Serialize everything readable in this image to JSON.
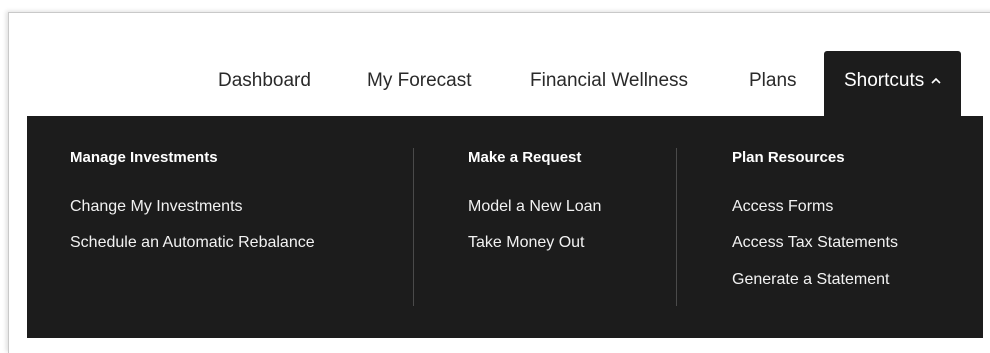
{
  "nav": {
    "items": [
      "Dashboard",
      "My Forecast",
      "Financial Wellness",
      "Plans"
    ],
    "active_label": "Shortcuts"
  },
  "menu": {
    "columns": [
      {
        "title": "Manage Investments",
        "links": [
          "Change My Investments",
          "Schedule an Automatic Rebalance"
        ]
      },
      {
        "title": "Make a Request",
        "links": [
          "Model a New Loan",
          "Take Money Out"
        ]
      },
      {
        "title": "Plan Resources",
        "links": [
          "Access Forms",
          "Access Tax Statements",
          "Generate a Statement"
        ]
      }
    ]
  },
  "colors": {
    "panel_bg": "#1c1c1c",
    "text_dark": "#2a2a2a",
    "text_light": "#ffffff"
  }
}
